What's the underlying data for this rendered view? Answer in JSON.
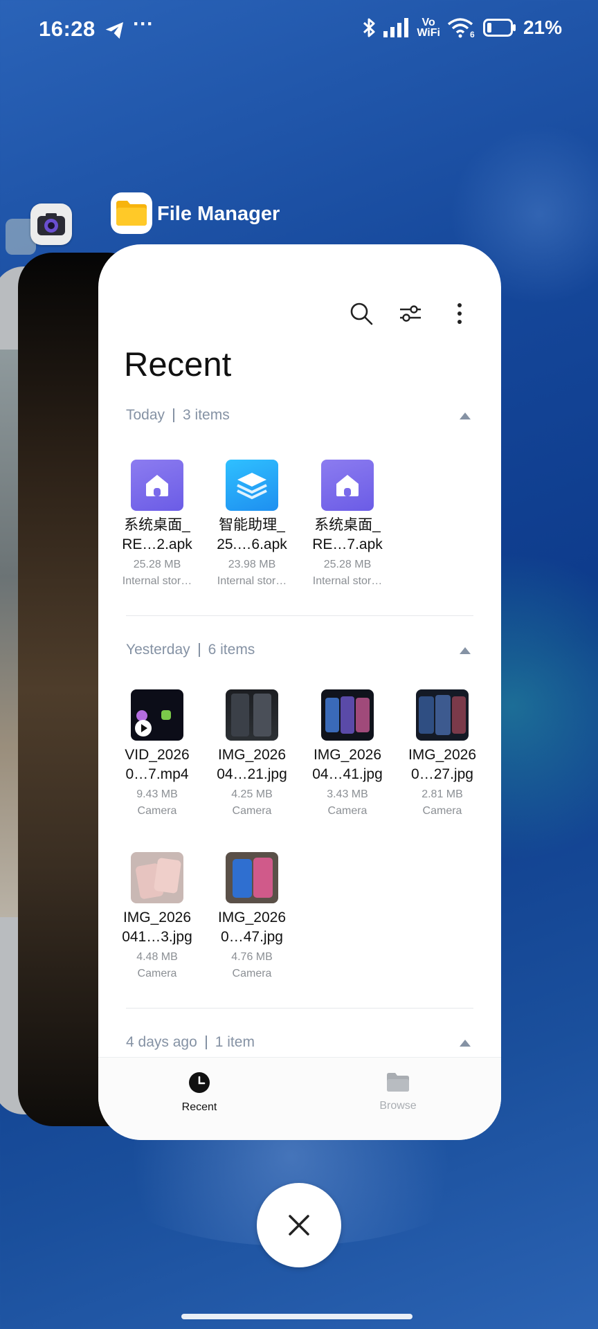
{
  "status_bar": {
    "time": "16:28",
    "more": "···",
    "vowifi_top": "Vo",
    "vowifi_bottom": "WiFi",
    "wifi_badge": "6",
    "battery_percent": "21%",
    "icons": [
      "telegram-icon",
      "bluetooth-icon",
      "signal-icon",
      "wifi-icon",
      "battery-icon"
    ]
  },
  "recents": {
    "background_apps": [
      "camera-icon"
    ],
    "active_app": {
      "name": "File Manager",
      "icon": "folder-icon"
    }
  },
  "file_manager": {
    "title": "Recent",
    "toolbar": [
      "search-icon",
      "filter-icon",
      "more-vert-icon"
    ],
    "sections": [
      {
        "label": "Today",
        "count": "3 items",
        "items": [
          {
            "name_l1": "系统桌面_",
            "name_l2": "RE…2.apk",
            "size": "25.28 MB",
            "location": "Internal stor…",
            "type": "home-apk"
          },
          {
            "name_l1": "智能助理_",
            "name_l2": "25.…6.apk",
            "size": "23.98 MB",
            "location": "Internal stor…",
            "type": "layers-apk"
          },
          {
            "name_l1": "系统桌面_",
            "name_l2": "RE…7.apk",
            "size": "25.28 MB",
            "location": "Internal stor…",
            "type": "home-apk"
          }
        ]
      },
      {
        "label": "Yesterday",
        "count": "6 items",
        "items": [
          {
            "name_l1": "VID_2026",
            "name_l2": "0…7.mp4",
            "size": "9.43 MB",
            "location": "Camera",
            "type": "video"
          },
          {
            "name_l1": "IMG_2026",
            "name_l2": "04…21.jpg",
            "size": "4.25 MB",
            "location": "Camera",
            "type": "image"
          },
          {
            "name_l1": "IMG_2026",
            "name_l2": "04…41.jpg",
            "size": "3.43 MB",
            "location": "Camera",
            "type": "image"
          },
          {
            "name_l1": "IMG_2026",
            "name_l2": "0…27.jpg",
            "size": "2.81 MB",
            "location": "Camera",
            "type": "image"
          },
          {
            "name_l1": "IMG_2026",
            "name_l2": "041…3.jpg",
            "size": "4.48 MB",
            "location": "Camera",
            "type": "image"
          },
          {
            "name_l1": "IMG_2026",
            "name_l2": "0…47.jpg",
            "size": "4.76 MB",
            "location": "Camera",
            "type": "image"
          }
        ]
      },
      {
        "label": "4 days ago",
        "count": "1 item",
        "items": []
      }
    ],
    "bottom_nav": [
      {
        "label": "Recent",
        "icon": "clock-icon",
        "active": true
      },
      {
        "label": "Browse",
        "icon": "folder-icon",
        "active": false
      }
    ]
  },
  "close_all": {
    "icon": "close-icon"
  },
  "colors": {
    "accent": "#111111",
    "muted": "#8592a4",
    "inactive": "#a9adb2"
  }
}
